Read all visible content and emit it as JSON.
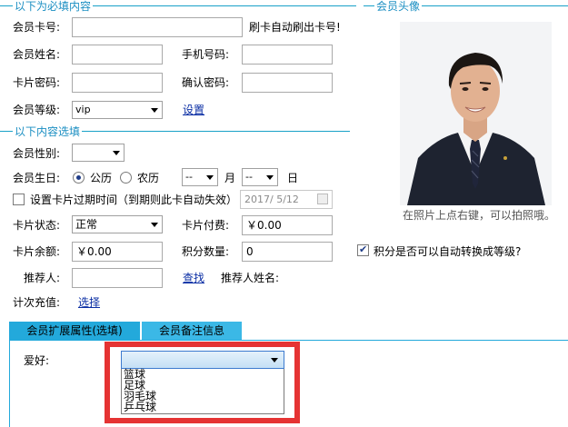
{
  "required_section": {
    "title": "以下为必填内容"
  },
  "photo_section": {
    "title": "会员头像",
    "hint": "在照片上点右键，可以拍照哦。"
  },
  "optional_section": {
    "title": "以下内容选填"
  },
  "fields": {
    "card_no_label": "会员卡号:",
    "card_no_value": "",
    "card_no_hint": "刷卡自动刷出卡号!",
    "name_label": "会员姓名:",
    "name_value": "",
    "phone_label": "手机号码:",
    "phone_value": "",
    "card_pwd_label": "卡片密码:",
    "card_pwd_value": "",
    "confirm_pwd_label": "确认密码:",
    "confirm_pwd_value": "",
    "level_label": "会员等级:",
    "level_value": "vip",
    "level_settings_link": "设置",
    "gender_label": "会员性别:",
    "gender_value": "",
    "birthday_label": "会员生日:",
    "calendar_solar": "公历",
    "calendar_lunar": "农历",
    "month_value": "--",
    "month_suffix": "月",
    "day_value": "--",
    "day_suffix": "日",
    "expiry_checkbox_label": "设置卡片过期时间（到期则此卡自动失效）",
    "expiry_date_value": "2017/ 5/12",
    "card_status_label": "卡片状态:",
    "card_status_value": "正常",
    "card_fee_label": "卡片付费:",
    "card_fee_value": "￥0.00",
    "card_balance_label": "卡片余额:",
    "card_balance_value": "￥0.00",
    "points_label": "积分数量:",
    "points_value": "0",
    "auto_level_label": "积分是否可以自动转换成等级?",
    "referrer_label": "推荐人:",
    "referrer_value": "",
    "lookup_link": "查找",
    "referrer_name_label": "推荐人姓名:",
    "recharge_label": "计次充值:",
    "recharge_link": "选择"
  },
  "tabs": [
    {
      "label": "会员扩展属性(选填)"
    },
    {
      "label": "会员备注信息"
    }
  ],
  "hobby": {
    "label": "爱好:",
    "selected": "",
    "options": [
      "篮球",
      "足球",
      "羽毛球",
      "乒乓球"
    ]
  },
  "colors": {
    "accent": "#23a9db",
    "section_text": "#1a8ec2",
    "highlight_border": "#e53333",
    "link": "#0a2ea4"
  }
}
